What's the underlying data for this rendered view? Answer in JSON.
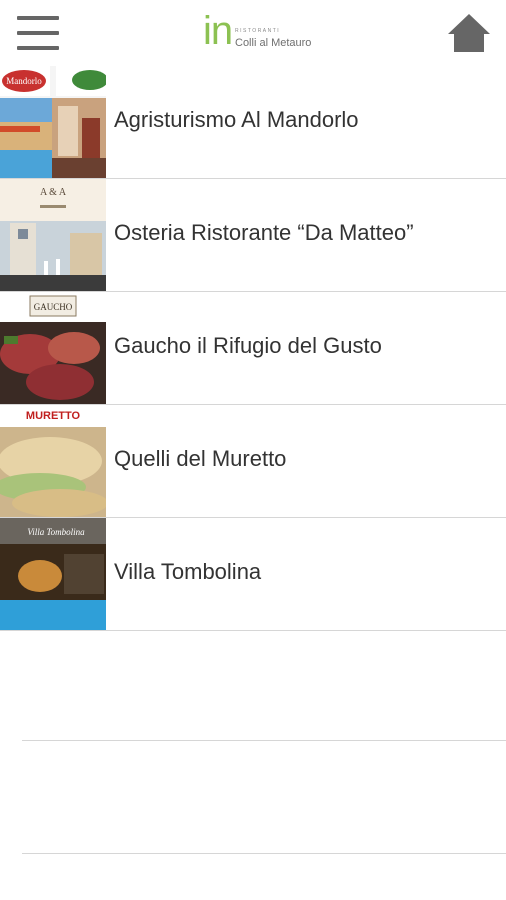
{
  "header": {
    "logo_mark": "in",
    "logo_small": "RISTORANTI",
    "logo_sub": "Colli al Metauro",
    "menu_icon": "hamburger-menu-icon",
    "home_icon": "home-icon"
  },
  "restaurants": [
    {
      "name": "Agristurismo Al Mandorlo",
      "thumb_text": "Mandorlo"
    },
    {
      "name": "Osteria Ristorante “Da Matteo”",
      "thumb_text": ""
    },
    {
      "name": "Gaucho il Rifugio del Gusto",
      "thumb_text": "GAUCHO"
    },
    {
      "name": "Quelli del Muretto",
      "thumb_text": "MURETTO"
    },
    {
      "name": "Villa Tombolina",
      "thumb_text": "Villa Tombolina"
    }
  ],
  "colors": {
    "accent": "#8cc152",
    "icon": "#666666",
    "divider": "#d6d6d6",
    "text": "#333333"
  }
}
